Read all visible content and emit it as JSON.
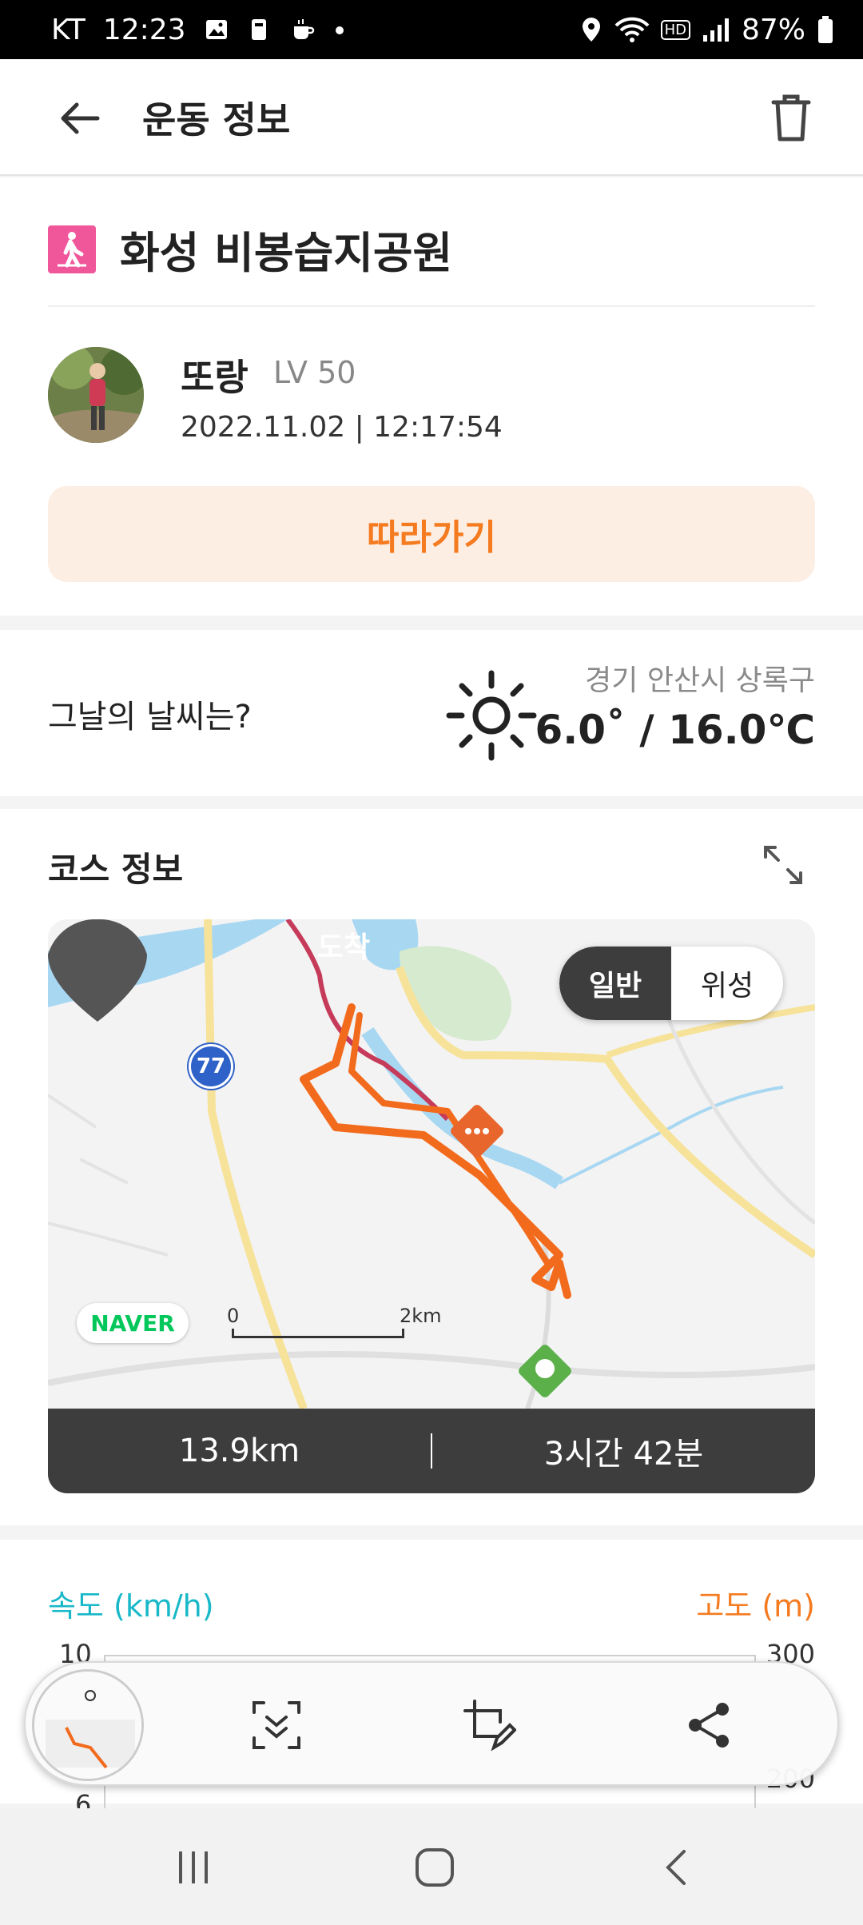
{
  "status_bar": {
    "carrier": "KT",
    "time": "12:23",
    "battery": "87%",
    "network_badge": "HD"
  },
  "header": {
    "title": "운동 정보"
  },
  "activity": {
    "place": "화성 비봉습지공원",
    "user_name": "또랑",
    "user_level": "LV 50",
    "datetime": "2022.11.02 | 12:17:54",
    "follow_label": "따라가기"
  },
  "weather": {
    "question": "그날의 날씨는?",
    "location": "경기 안산시 상록구",
    "temperature": "6.0˚ / 16.0℃"
  },
  "course": {
    "title": "코스 정보",
    "map": {
      "arrive_label": "도착",
      "mode_normal": "일반",
      "mode_satellite": "위성",
      "route_number": "77",
      "provider": "NAVER",
      "scale_start": "0",
      "scale_end": "2km"
    },
    "distance": "13.9km",
    "duration": "3시간 42분"
  },
  "chart": {
    "speed_label": "속도 (km/h)",
    "altitude_label": "고도 (m)",
    "speed_ticks": [
      "10",
      "6"
    ],
    "altitude_ticks": [
      "300",
      "200"
    ]
  },
  "colors": {
    "accent": "#f47b20",
    "speed": "#18b8c8",
    "walk_badge": "#f0579b",
    "stats_bar": "#3d3d3d"
  }
}
